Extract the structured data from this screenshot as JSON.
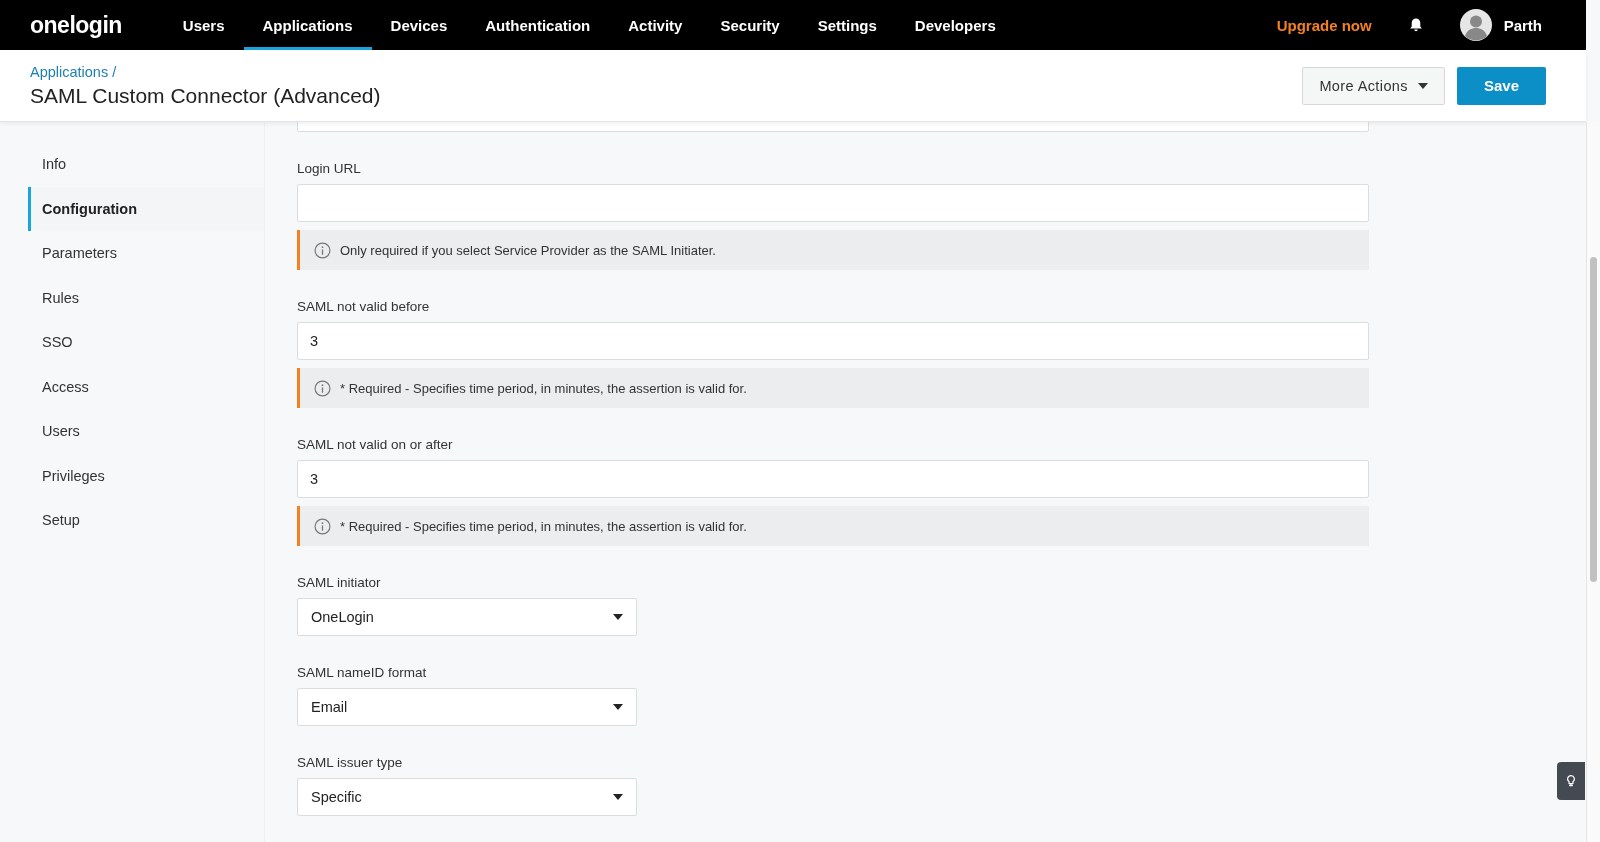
{
  "top_nav": {
    "logo": "onelogin",
    "items": [
      {
        "label": "Users",
        "selected": false
      },
      {
        "label": "Applications",
        "selected": true
      },
      {
        "label": "Devices",
        "selected": false
      },
      {
        "label": "Authentication",
        "selected": false
      },
      {
        "label": "Activity",
        "selected": false
      },
      {
        "label": "Security",
        "selected": false
      },
      {
        "label": "Settings",
        "selected": false
      },
      {
        "label": "Developers",
        "selected": false
      }
    ],
    "upgrade": "Upgrade now",
    "user": "Parth"
  },
  "header": {
    "breadcrumb": "Applications /",
    "title": "SAML Custom Connector (Advanced)",
    "more_actions": "More Actions",
    "save": "Save"
  },
  "sidebar": {
    "items": [
      {
        "label": "Info",
        "selected": false
      },
      {
        "label": "Configuration",
        "selected": true
      },
      {
        "label": "Parameters",
        "selected": false
      },
      {
        "label": "Rules",
        "selected": false
      },
      {
        "label": "SSO",
        "selected": false
      },
      {
        "label": "Access",
        "selected": false
      },
      {
        "label": "Users",
        "selected": false
      },
      {
        "label": "Privileges",
        "selected": false
      },
      {
        "label": "Setup",
        "selected": false
      }
    ]
  },
  "form": {
    "fields": [
      {
        "kind": "text",
        "label": "Login URL",
        "note": "Only required if you select Service Provider as the SAML Initiater."
      },
      {
        "kind": "text",
        "label": "SAML not valid before",
        "value": "3",
        "note": "* Required - Specifies time period, in minutes, the assertion is valid for."
      },
      {
        "kind": "text",
        "label": "SAML not valid on or after",
        "value": "3",
        "note": "* Required - Specifies time period, in minutes, the assertion is valid for."
      },
      {
        "kind": "select",
        "label": "SAML initiator",
        "value": "OneLogin"
      },
      {
        "kind": "select",
        "label": "SAML nameID format",
        "value": "Email"
      },
      {
        "kind": "select",
        "label": "SAML issuer type",
        "value": "Specific"
      }
    ]
  }
}
